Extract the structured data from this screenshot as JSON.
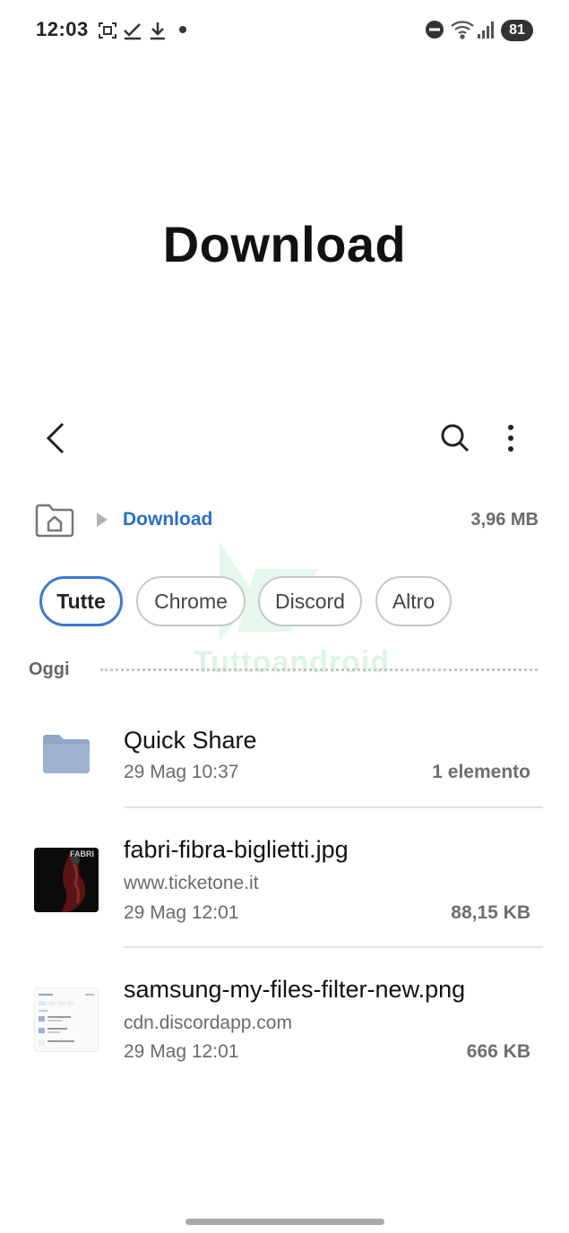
{
  "status_bar": {
    "time": "12:03",
    "battery": "81"
  },
  "header": {
    "title": "Download"
  },
  "breadcrumb": {
    "label": "Download",
    "storage_size": "3,96 MB"
  },
  "filters": [
    {
      "label": "Tutte",
      "active": true
    },
    {
      "label": "Chrome",
      "active": false
    },
    {
      "label": "Discord",
      "active": false
    },
    {
      "label": "Altro",
      "active": false
    }
  ],
  "section": {
    "label": "Oggi"
  },
  "watermark": {
    "text": "Tuttoandroid"
  },
  "files": [
    {
      "name": "Quick Share",
      "date": "29 Mag 10:37",
      "size": "1 elemento",
      "icon": "folder-icon"
    },
    {
      "name": "fabri-fibra-biglietti.jpg",
      "source": "www.ticketone.it",
      "date": "29 Mag 12:01",
      "size": "88,15 KB",
      "thumb_text": "FABRI"
    },
    {
      "name": "samsung-my-files-filter-new.png",
      "source": "cdn.discordapp.com",
      "date": "29 Mag 12:01",
      "size": "666 KB"
    }
  ],
  "colors": {
    "accent": "#3b78d4",
    "breadcrumb": "#2a6fca",
    "folder": "#8fa6c4",
    "secondary_text": "#6a6a6a"
  }
}
